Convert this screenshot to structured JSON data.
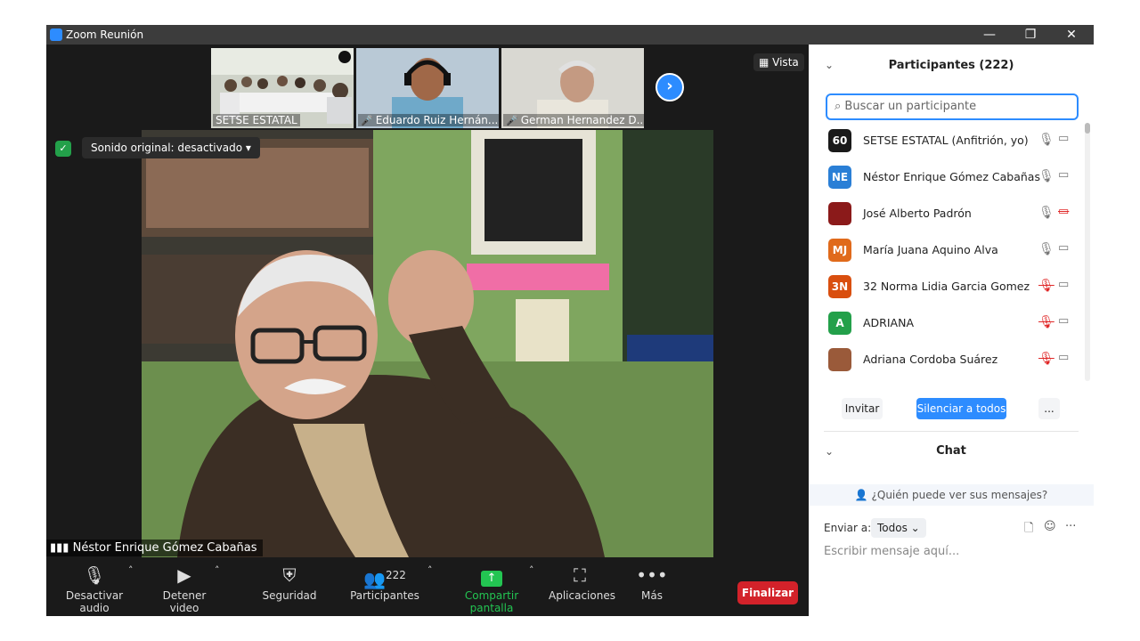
{
  "window": {
    "title": "Zoom Reunión",
    "minimize": "—",
    "restore": "❐",
    "close": "✕"
  },
  "gallery": {
    "thumbnails": [
      {
        "label": "SETSE ESTATAL",
        "muted": false
      },
      {
        "label": "Eduardo Ruiz Hernán...",
        "muted": true
      },
      {
        "label": "German Hernandez D...",
        "muted": true
      }
    ],
    "next_icon": "›",
    "view_label": "Vista"
  },
  "main_video": {
    "sound_label": "Sonido original: desactivado",
    "speaker_name": "Néstor Enrique Gómez Cabañas"
  },
  "toolbar": {
    "audio_label": "Desactivar audio",
    "video_label": "Detener video",
    "security_label": "Seguridad",
    "participants_label": "Participantes",
    "participants_count": "222",
    "share_label": "Compartir pantalla",
    "apps_label": "Aplicaciones",
    "more_label": "Más",
    "end_label": "Finalizar",
    "accent_share": "#23c552",
    "accent_end": "#d3222a"
  },
  "participants_panel": {
    "title": "Participantes (222)",
    "search_placeholder": "Buscar un participante",
    "rows": [
      {
        "initials": "60",
        "name": "SETSE ESTATAL (Anfitrión, yo)",
        "color": "#1a1a1a",
        "mic": "on",
        "cam": "on"
      },
      {
        "initials": "NE",
        "name": "Néstor Enrique Gómez Cabañas",
        "color": "#2a7fd6",
        "mic": "on",
        "cam": "on"
      },
      {
        "initials": "",
        "name": "José Alberto Padrón",
        "color": "#8b1a1a",
        "mic": "on",
        "cam": "off"
      },
      {
        "initials": "MJ",
        "name": "María Juana Aquino Alva",
        "color": "#e06a1b",
        "mic": "on",
        "cam": "on"
      },
      {
        "initials": "3N",
        "name": "32 Norma Lidia Garcia Gomez",
        "color": "#d94f0f",
        "mic": "off",
        "cam": "on"
      },
      {
        "initials": "A",
        "name": "ADRIANA",
        "color": "#23a04a",
        "mic": "off",
        "cam": "on"
      },
      {
        "initials": "",
        "name": "Adriana Cordoba Suárez",
        "color": "#9a5a3a",
        "mic": "off",
        "cam": "on"
      }
    ],
    "invite_label": "Invitar",
    "mute_all_label": "Silenciar a todos",
    "more_label": "..."
  },
  "chat": {
    "title": "Chat",
    "who_can_see": "¿Quién puede ver sus mensajes?",
    "send_to_label": "Enviar a:",
    "send_to_value": "Todos",
    "input_placeholder": "Escribir mensaje aquí..."
  }
}
